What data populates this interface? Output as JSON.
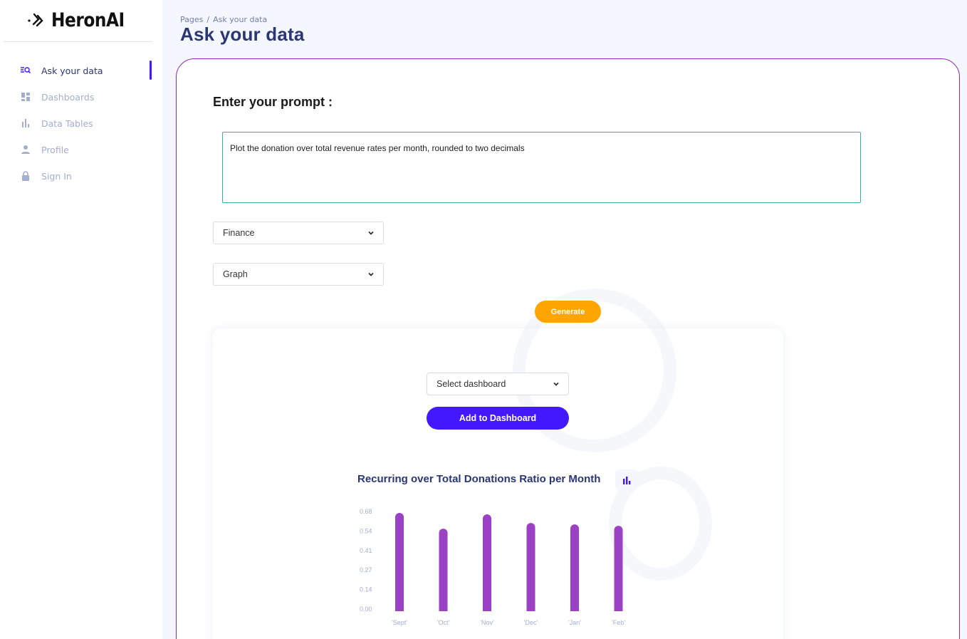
{
  "brand": {
    "name": "HeronAI"
  },
  "sidebar": {
    "items": [
      {
        "label": "Ask your data",
        "icon": "search-list-icon",
        "active": true
      },
      {
        "label": "Dashboards",
        "icon": "dashboard-icon",
        "active": false
      },
      {
        "label": "Data Tables",
        "icon": "bar-chart-icon",
        "active": false
      },
      {
        "label": "Profile",
        "icon": "person-icon",
        "active": false
      },
      {
        "label": "Sign In",
        "icon": "lock-icon",
        "active": false
      }
    ]
  },
  "header": {
    "breadcrumb_root": "Pages",
    "breadcrumb_separator": "/",
    "breadcrumb_current": "Ask your data",
    "title": "Ask your data"
  },
  "form": {
    "prompt_heading": "Enter your prompt :",
    "prompt_value": "Plot the donation over total revenue rates per month, rounded to two decimals",
    "category_select": "Finance",
    "output_select": "Graph",
    "generate_label": "Generate"
  },
  "result": {
    "dashboard_select": "Select dashboard",
    "add_dashboard_label": "Add to Dashboard"
  },
  "colors": {
    "accent": "#4318ff",
    "generate": "#ffa500",
    "bar": "#9b42c4",
    "card_border": "#8e2bb5",
    "title": "#2b3674"
  },
  "chart_data": {
    "type": "bar",
    "title": "Recurring over Total Donations Ratio per Month",
    "categories": [
      "'Sept'",
      "'Oct'",
      "'Nov'",
      "'Dec'",
      "'Jan'",
      "'Feb'"
    ],
    "values": [
      0.67,
      0.56,
      0.66,
      0.6,
      0.59,
      0.58
    ],
    "ytick_labels": [
      "0.68",
      "0.54",
      "0.41",
      "0.27",
      "0.14",
      "0.00"
    ],
    "ylim": [
      0,
      0.68
    ],
    "grid": false,
    "xlabel": "",
    "ylabel": ""
  }
}
